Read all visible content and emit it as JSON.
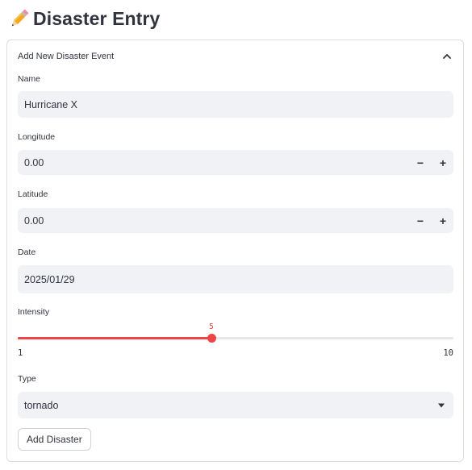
{
  "page": {
    "title": "Disaster Entry",
    "title_icon": "pencil-icon"
  },
  "expander": {
    "title": "Add New Disaster Event",
    "chevron_icon": "chevron-up-icon",
    "expanded": true
  },
  "form": {
    "name": {
      "label": "Name",
      "value": "Hurricane X"
    },
    "longitude": {
      "label": "Longitude",
      "value": "0.00",
      "minus": "−",
      "plus": "+"
    },
    "latitude": {
      "label": "Latitude",
      "value": "0.00",
      "minus": "−",
      "plus": "+"
    },
    "date": {
      "label": "Date",
      "value": "2025/01/29"
    },
    "intensity": {
      "label": "Intensity",
      "value": 5,
      "value_text": "5",
      "min": 1,
      "min_text": "1",
      "max": 10,
      "max_text": "10"
    },
    "type": {
      "label": "Type",
      "value": "tornado"
    },
    "submit_label": "Add Disaster"
  },
  "colors": {
    "accent": "#ee4444",
    "input_bg": "#f0f2f6",
    "text": "#31333f"
  }
}
